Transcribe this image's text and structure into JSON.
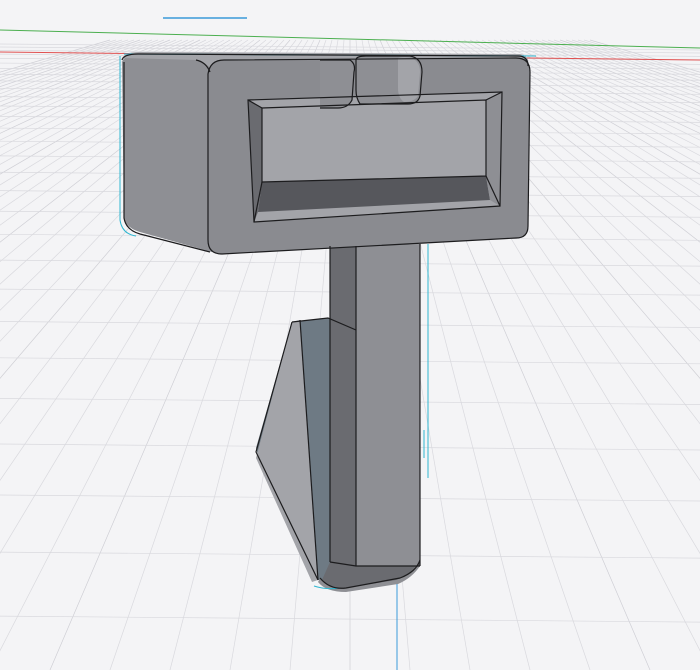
{
  "viewport": {
    "background": "#f4f4f6",
    "grid_color": "#d9d9de",
    "grid_major_color": "#cfcfd5"
  },
  "axes": {
    "x_axis_color": "#e05050",
    "y_axis_color": "#4caf50",
    "z_axis_color": "#3a9ad9"
  },
  "model": {
    "body_color": "#8a8b90",
    "face_light": "#a3a4a9",
    "face_mid": "#8e8f94",
    "face_dark": "#6a6b70",
    "face_darker": "#56575c",
    "flap_color": "#6e7a84",
    "edge_color": "#1c1c1e",
    "selection_color": "#2fb6d0"
  },
  "icons": {
    "orbit": "view-orbit-icon"
  }
}
